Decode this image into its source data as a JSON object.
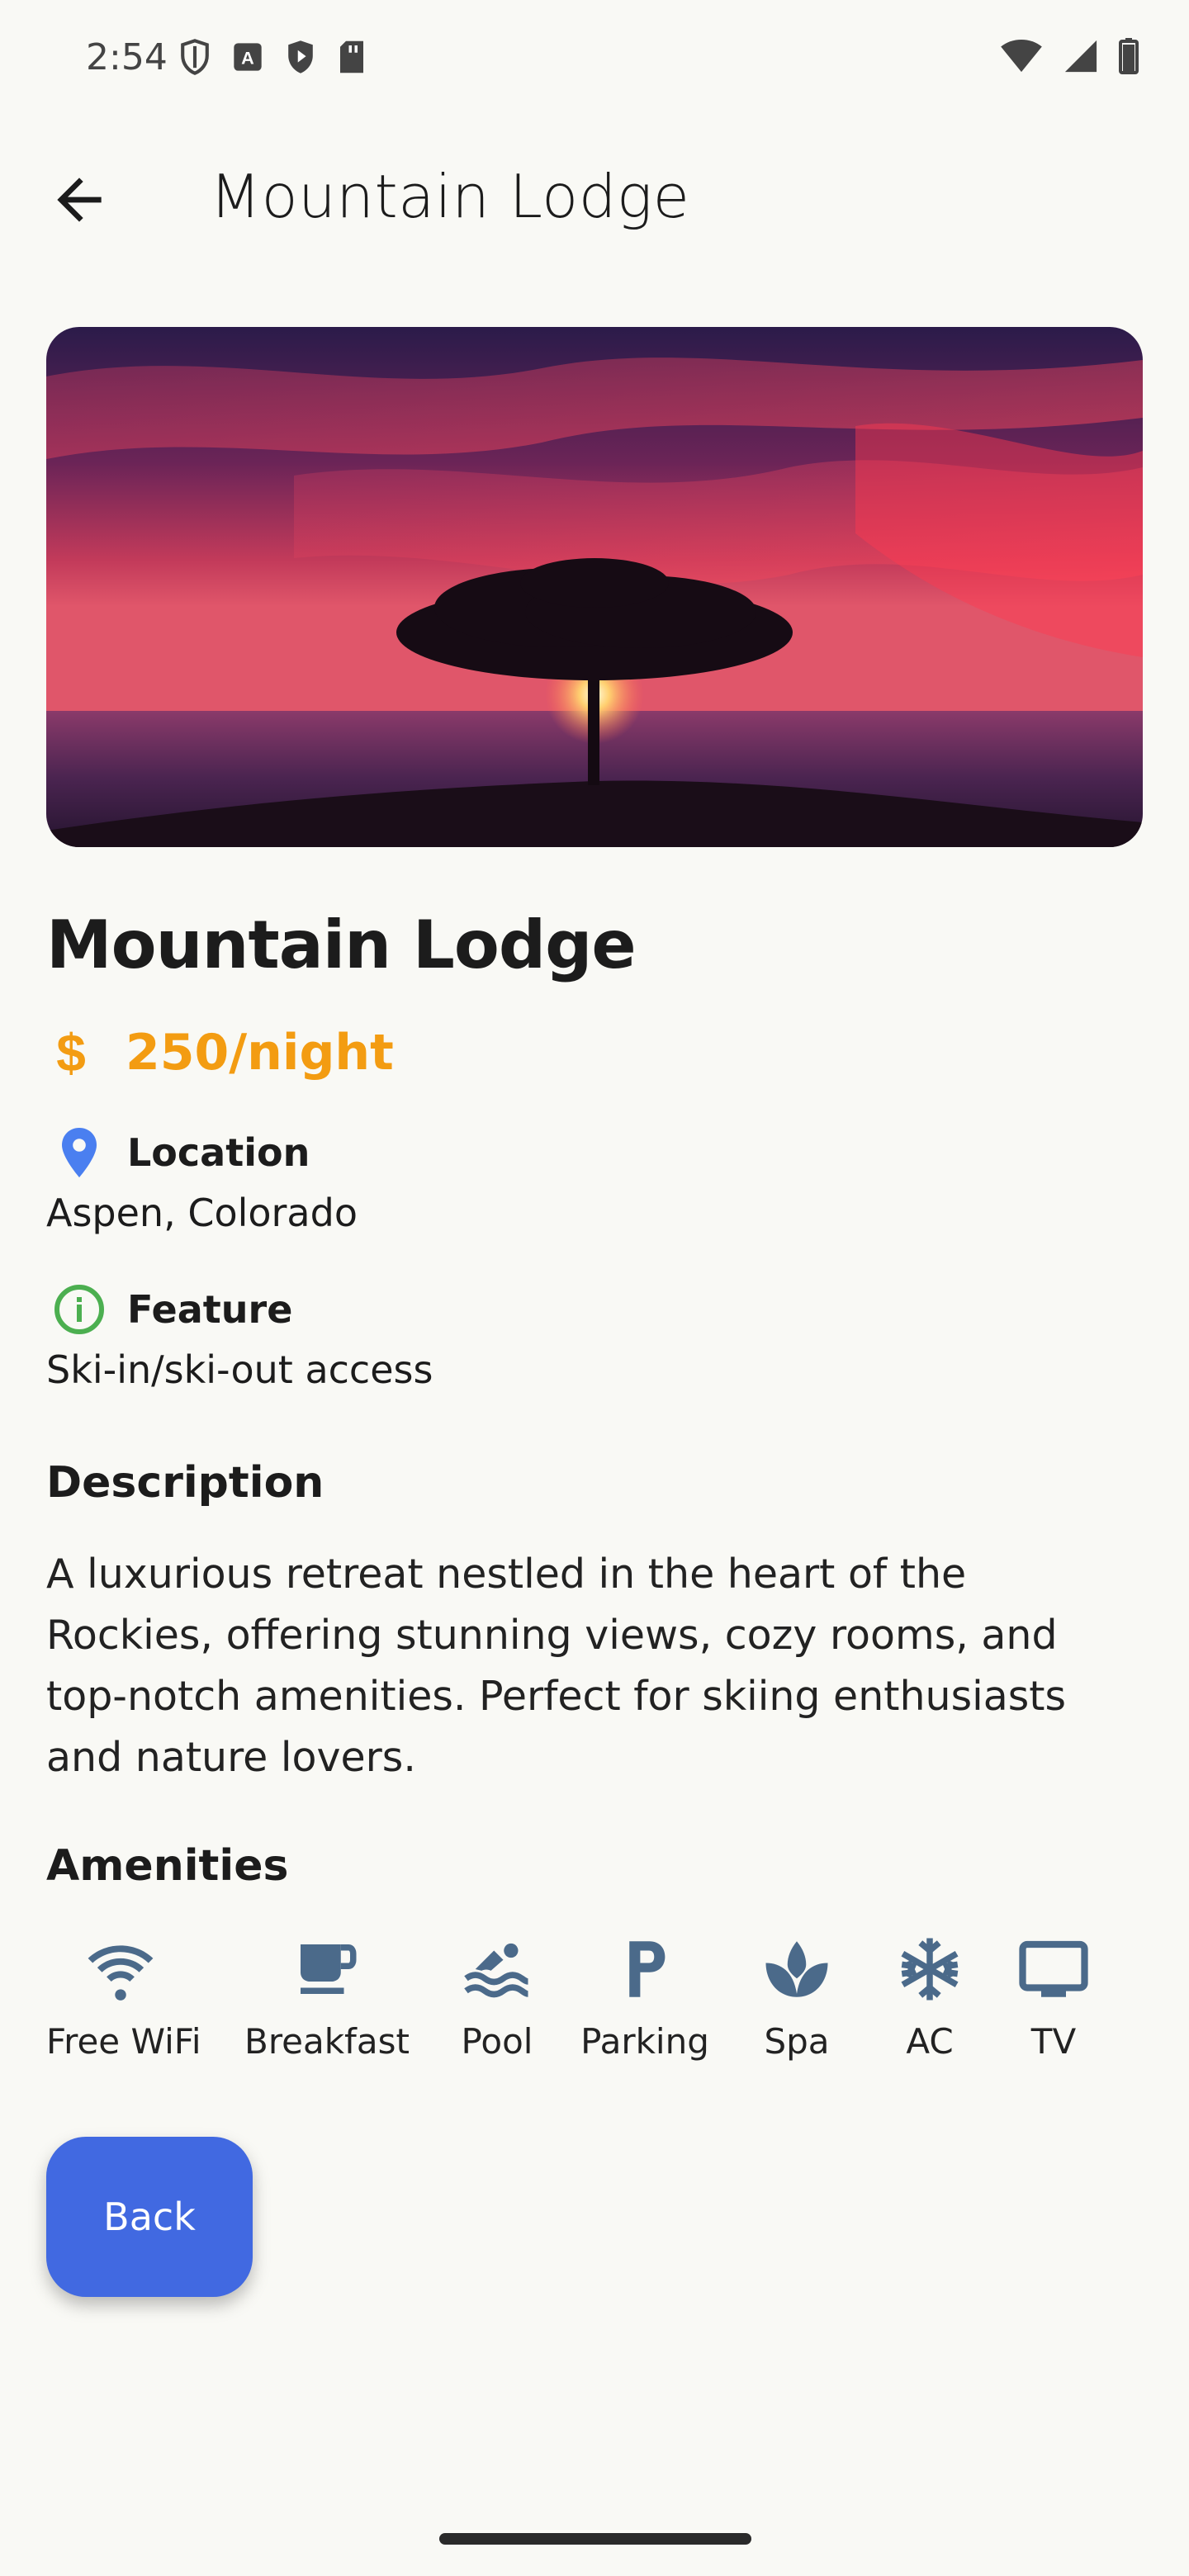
{
  "status_bar": {
    "time": "2:54"
  },
  "app_bar": {
    "title": "Mountain Lodge"
  },
  "lodge": {
    "title": "Mountain Lodge",
    "currency_symbol": "$",
    "price": "250/night",
    "location_label": "Location",
    "location_value": "Aspen, Colorado",
    "feature_label": "Feature",
    "feature_value": "Ski-in/ski-out access",
    "description_title": "Description",
    "description": "A luxurious retreat nestled in the heart of the Rockies, offering stunning views, cozy rooms, and top-notch amenities. Perfect for skiing enthusiasts and nature lovers.",
    "amenities_title": "Amenities"
  },
  "amenities": [
    {
      "label": "Free WiFi",
      "icon": "wifi-icon"
    },
    {
      "label": "Breakfast",
      "icon": "coffee-cup-icon"
    },
    {
      "label": "Pool",
      "icon": "pool-icon"
    },
    {
      "label": "Parking",
      "icon": "parking-icon"
    },
    {
      "label": "Spa",
      "icon": "spa-icon"
    },
    {
      "label": "AC",
      "icon": "snowflake-icon"
    },
    {
      "label": "TV",
      "icon": "tv-icon"
    }
  ],
  "actions": {
    "back_label": "Back"
  },
  "colors": {
    "price": "#f39c12",
    "location_pin": "#4a7ff0",
    "feature_info": "#4caf50",
    "amenity_icon": "#4b6a8a",
    "back_button": "#4169e1"
  }
}
